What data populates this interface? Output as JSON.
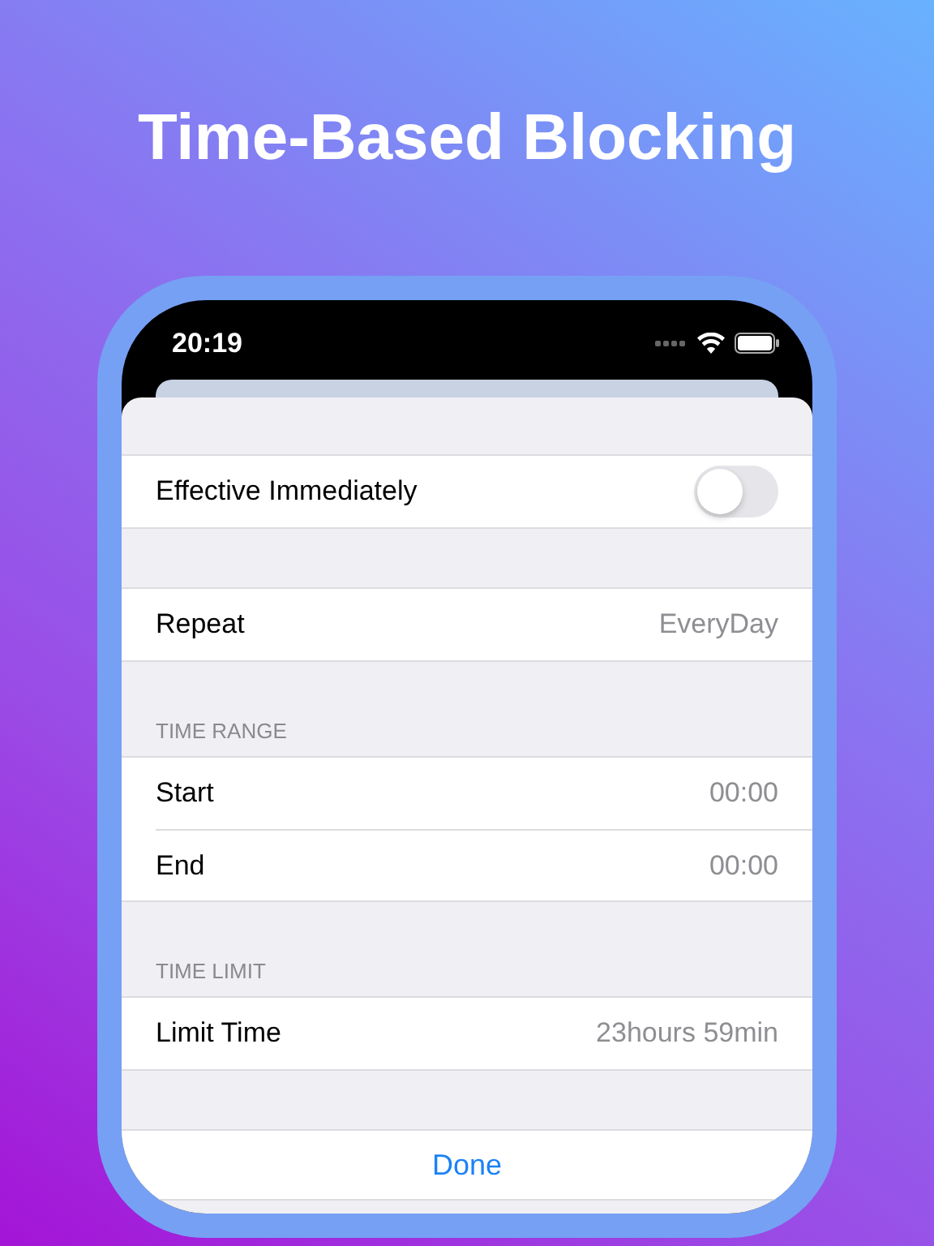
{
  "headline": "Time-Based Blocking",
  "status_bar": {
    "time": "20:19"
  },
  "sections": [
    {
      "rows": [
        {
          "kind": "toggle",
          "label": "Effective Immediately",
          "on": false
        }
      ]
    },
    {
      "rows": [
        {
          "kind": "value",
          "label": "Repeat",
          "value": "EveryDay"
        }
      ]
    },
    {
      "header": "TIME RANGE",
      "rows": [
        {
          "kind": "value",
          "label": "Start",
          "value": "00:00"
        },
        {
          "kind": "value",
          "label": "End",
          "value": "00:00"
        }
      ]
    },
    {
      "header": "TIME LIMIT",
      "rows": [
        {
          "kind": "value",
          "label": "Limit Time",
          "value": "23hours 59min"
        }
      ]
    }
  ],
  "done_button": "Done"
}
